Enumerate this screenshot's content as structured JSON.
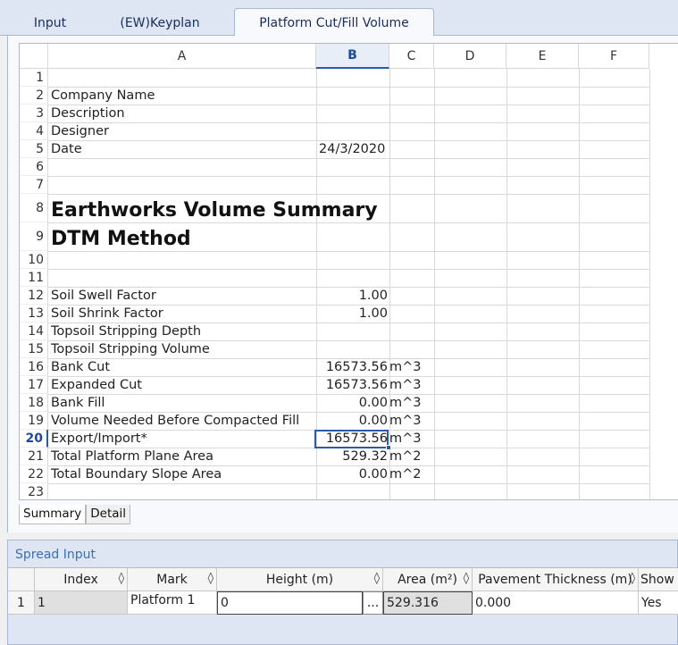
{
  "tabs": [
    {
      "label": "Input"
    },
    {
      "label": "(EW)Keyplan"
    },
    {
      "label": "Platform Cut/Fill Volume"
    }
  ],
  "sheet": {
    "columns": [
      "A",
      "B",
      "C",
      "D",
      "E",
      "F"
    ],
    "rows": [
      "1",
      "2",
      "3",
      "4",
      "5",
      "6",
      "7",
      "8",
      "9",
      "10",
      "11",
      "12",
      "13",
      "14",
      "15",
      "16",
      "17",
      "18",
      "19",
      "20",
      "21",
      "22",
      "23"
    ],
    "cells": {
      "r2a": "Company Name",
      "r3a": "Description",
      "r4a": "Designer",
      "r5a": "Date",
      "r5b": "24/3/2020",
      "r8a": "Earthworks Volume Summary",
      "r9a": "DTM Method",
      "r12a": "Soil Swell Factor",
      "r12b": "1.00",
      "r13a": "Soil Shrink Factor",
      "r13b": "1.00",
      "r14a": "Topsoil Stripping Depth",
      "r15a": "Topsoil Stripping Volume",
      "r16a": "Bank Cut",
      "r16b": "16573.56",
      "r16c": "m^3",
      "r17a": "Expanded Cut",
      "r17b": "16573.56",
      "r17c": "m^3",
      "r18a": "Bank Fill",
      "r18b": "0.00",
      "r18c": "m^3",
      "r19a": "Volume Needed Before Compacted Fill",
      "r19b": "0.00",
      "r19c": "m^3",
      "r20a": "Export/Import*",
      "r20b": "16573.56",
      "r20c": "m^3",
      "r21a": "Total Platform Plane Area",
      "r21b": "529.32",
      "r21c": "m^2",
      "r22a": "Total Boundary Slope Area",
      "r22b": "0.00",
      "r22c": "m^2"
    },
    "sheet_tabs": [
      "Summary",
      "Detail"
    ]
  },
  "spread": {
    "title": "Spread Input",
    "sort_glyph": "◊",
    "headers": [
      "Index",
      "Mark",
      "Height (m)",
      "Area (m²)",
      "Pavement Thickness (m)",
      "Show I"
    ],
    "row": {
      "num": "1",
      "index": "1",
      "mark": "Platform 1",
      "height": "0",
      "ellipsis": "...",
      "area": "529.316",
      "pavement": "0.000",
      "show": "Yes"
    }
  }
}
